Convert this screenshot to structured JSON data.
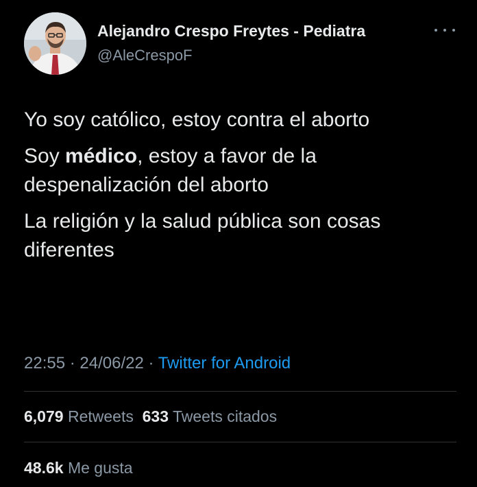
{
  "author": {
    "display_name": "Alejandro Crespo Freytes - Pediatra",
    "handle": "@AleCrespoF",
    "avatar_icon": "profile-photo"
  },
  "tweet": {
    "line1": "Yo soy católico, estoy contra el aborto",
    "line2_pre": "Soy ",
    "line2_bold": "médico",
    "line2_post": ", estoy a favor de la despenalización del aborto",
    "line3": "La religión y la salud pública son cosas diferentes"
  },
  "meta": {
    "time": "22:55",
    "separator": " · ",
    "date": "24/06/22",
    "source": "Twitter for Android"
  },
  "stats": {
    "retweets_count": "6,079",
    "retweets_label": "Retweets",
    "quotes_count": "633",
    "quotes_label": "Tweets citados",
    "likes_count": "48.6k",
    "likes_label": "Me gusta"
  },
  "colors": {
    "background": "#000000",
    "text": "#e7e9ea",
    "muted": "#8b98a5",
    "link": "#1d9bf0",
    "divider": "#2f3336"
  }
}
